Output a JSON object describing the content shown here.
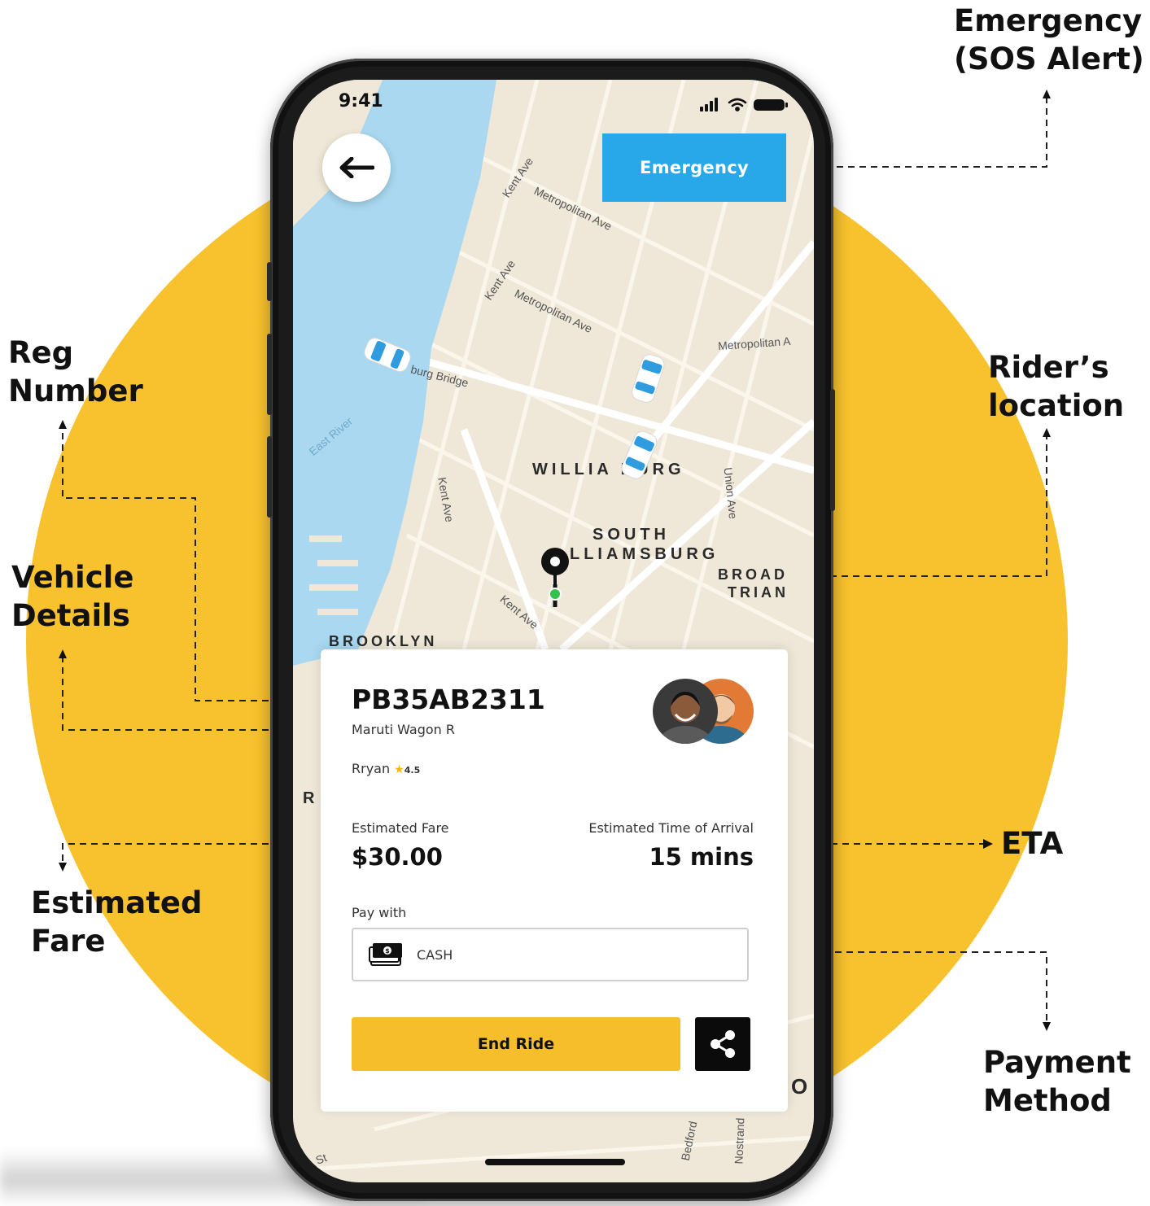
{
  "annotations": {
    "emergency": "Emergency (SOS Alert)",
    "emergency_line1": "Emergency",
    "emergency_line2": "(SOS Alert)",
    "reg_line1": "Reg",
    "reg_line2": "Number",
    "rider_line1": "Rider’s",
    "rider_line2": "location",
    "vehicle_line1": "Vehicle",
    "vehicle_line2": "Details",
    "eta": "ETA",
    "fare_line1": "Estimated",
    "fare_line2": "Fare",
    "payment_line1": "Payment",
    "payment_line2": "Method"
  },
  "status_bar": {
    "time": "9:41"
  },
  "toolbar": {
    "emergency_label": "Emergency"
  },
  "map": {
    "labels": {
      "williamsburg": "WILLIA   BURG",
      "south": "SOUTH",
      "south_williamsburg": "LLIAMSBURG",
      "broadway": "BROAD",
      "triangle": "TRIAN",
      "brooklyn": "BROOKLYN",
      "east_river": "East River",
      "bridge": "burg Bridge",
      "metropolitan1": "Metropolitan Ave",
      "metropolitan2": "Metropolitan Ave",
      "metropolitan3": "Metropolitan A",
      "kent1": "Kent Ave",
      "kent2": "Kent Ave",
      "kent3": "Kent Ave",
      "kent4": "Kent Ave",
      "union": "Union Ave",
      "bedford": "Bedford",
      "nostrand": "Nostrand",
      "st": "St",
      "r_letter": "R",
      "o_letter": "O"
    }
  },
  "ride": {
    "reg_number": "PB35AB2311",
    "vehicle_model": "Maruti Wagon R",
    "driver_name": "Rryan",
    "rating": "4.5",
    "estimated_fare_label": "Estimated Fare",
    "estimated_fare": "$30.00",
    "eta_label": "Estimated Time of Arrival",
    "eta": "15 mins",
    "pay_with_label": "Pay with",
    "payment_method": "CASH",
    "end_ride_label": "End Ride"
  },
  "colors": {
    "accent_yellow": "#F8C22E",
    "emergency_blue": "#28A7E9",
    "water": "#A9D8F0",
    "land": "#EFE8D8"
  },
  "icons": [
    "back-arrow-icon",
    "signal-icon",
    "wifi-icon",
    "battery-icon",
    "car-icon",
    "location-pin-icon",
    "star-icon",
    "cash-icon",
    "share-icon"
  ]
}
